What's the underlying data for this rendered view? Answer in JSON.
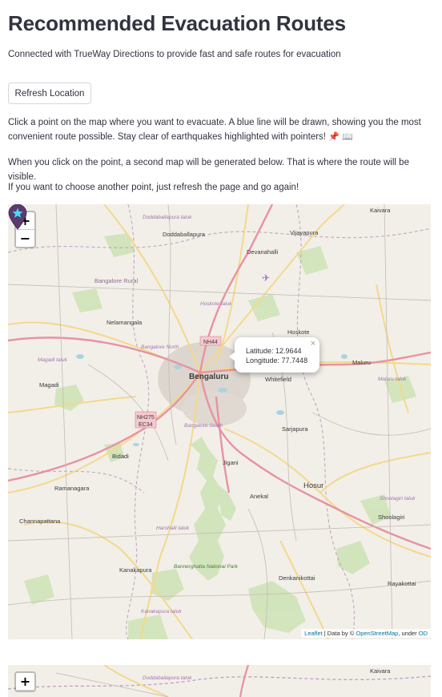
{
  "page": {
    "title": "Recommended Evacuation Routes",
    "subtitle": "Connected with TrueWay Directions to provide fast and safe routes for evacuation",
    "refresh_button": "Refresh Location",
    "instructions": [
      "Click a point on the map where you want to evacuate. A blue line will be drawn, showing you the most convenient route possible. Stay clear of earthquakes highlighted with pointers!",
      "When you click on the point, a second map will be generated below. That is where the route will be visible.",
      "If you want to choose another point, just refresh the page and go again!"
    ],
    "instruction_emojis": [
      "📌",
      "📖"
    ]
  },
  "map": {
    "zoom_in": "+",
    "zoom_out": "−",
    "popup": {
      "close": "×",
      "latitude": "Latitude: 12.9644",
      "longitude": "Longitude: 77.7448"
    },
    "marker": {
      "icon": "star-marker-icon",
      "color": "#5b3a6e"
    },
    "attribution": {
      "leaflet": "Leaflet",
      "data_by": " | Data by © ",
      "osm": "OpenStreetMap",
      "under": ", under ",
      "license": "OD"
    },
    "places": {
      "kaivara": "Kaivara",
      "doddaballapura_taluk": "Doddaballapura taluk",
      "doddaballapura": "Doddaballapura",
      "vijayapura": "Vijayapura",
      "devanahalli": "Devanahalli",
      "bangalore_rural": "Bangalore Rural",
      "hoskote_taluk": "Hoskote taluk",
      "nelamangala": "Nelamangala",
      "hoskote": "Hoskote",
      "bangalore_north": "Bangalore North",
      "nh44": "NH44",
      "magadi_taluk": "Magadi taluk",
      "bengaluru": "Bengaluru",
      "whitefield": "Whitefield",
      "maluru": "Maluru",
      "maluru_taluk": "Maluru taluk",
      "magadi": "Magadi",
      "nh275": "NH275",
      "ec34": "EC34",
      "bangalore_south": "Bangalore South",
      "sarjapura": "Sarjapura",
      "bidadi": "Bidadi",
      "jigani": "Jigani",
      "ramanagara": "Ramanagara",
      "hosur": "Hosur",
      "anekal": "Anekal",
      "shoolagiri_taluk": "Shoolagiri taluk",
      "channapattana": "Channapattana",
      "shoolagiri": "Shoolagiri",
      "harohalli_taluk": "Harohalli taluk",
      "kanakapura": "Kanakapura",
      "bannerghatta": "Bannerghatta National Park",
      "denkanikottai": "Denkanikottai",
      "rayakottai": "Rayakottai",
      "kanakapura_taluk": "Kanakapura taluk"
    },
    "second_map": {
      "zoom_in": "+",
      "kaivara": "Kaivara",
      "doddaballapura_taluk": "Doddaballapura taluk"
    }
  }
}
